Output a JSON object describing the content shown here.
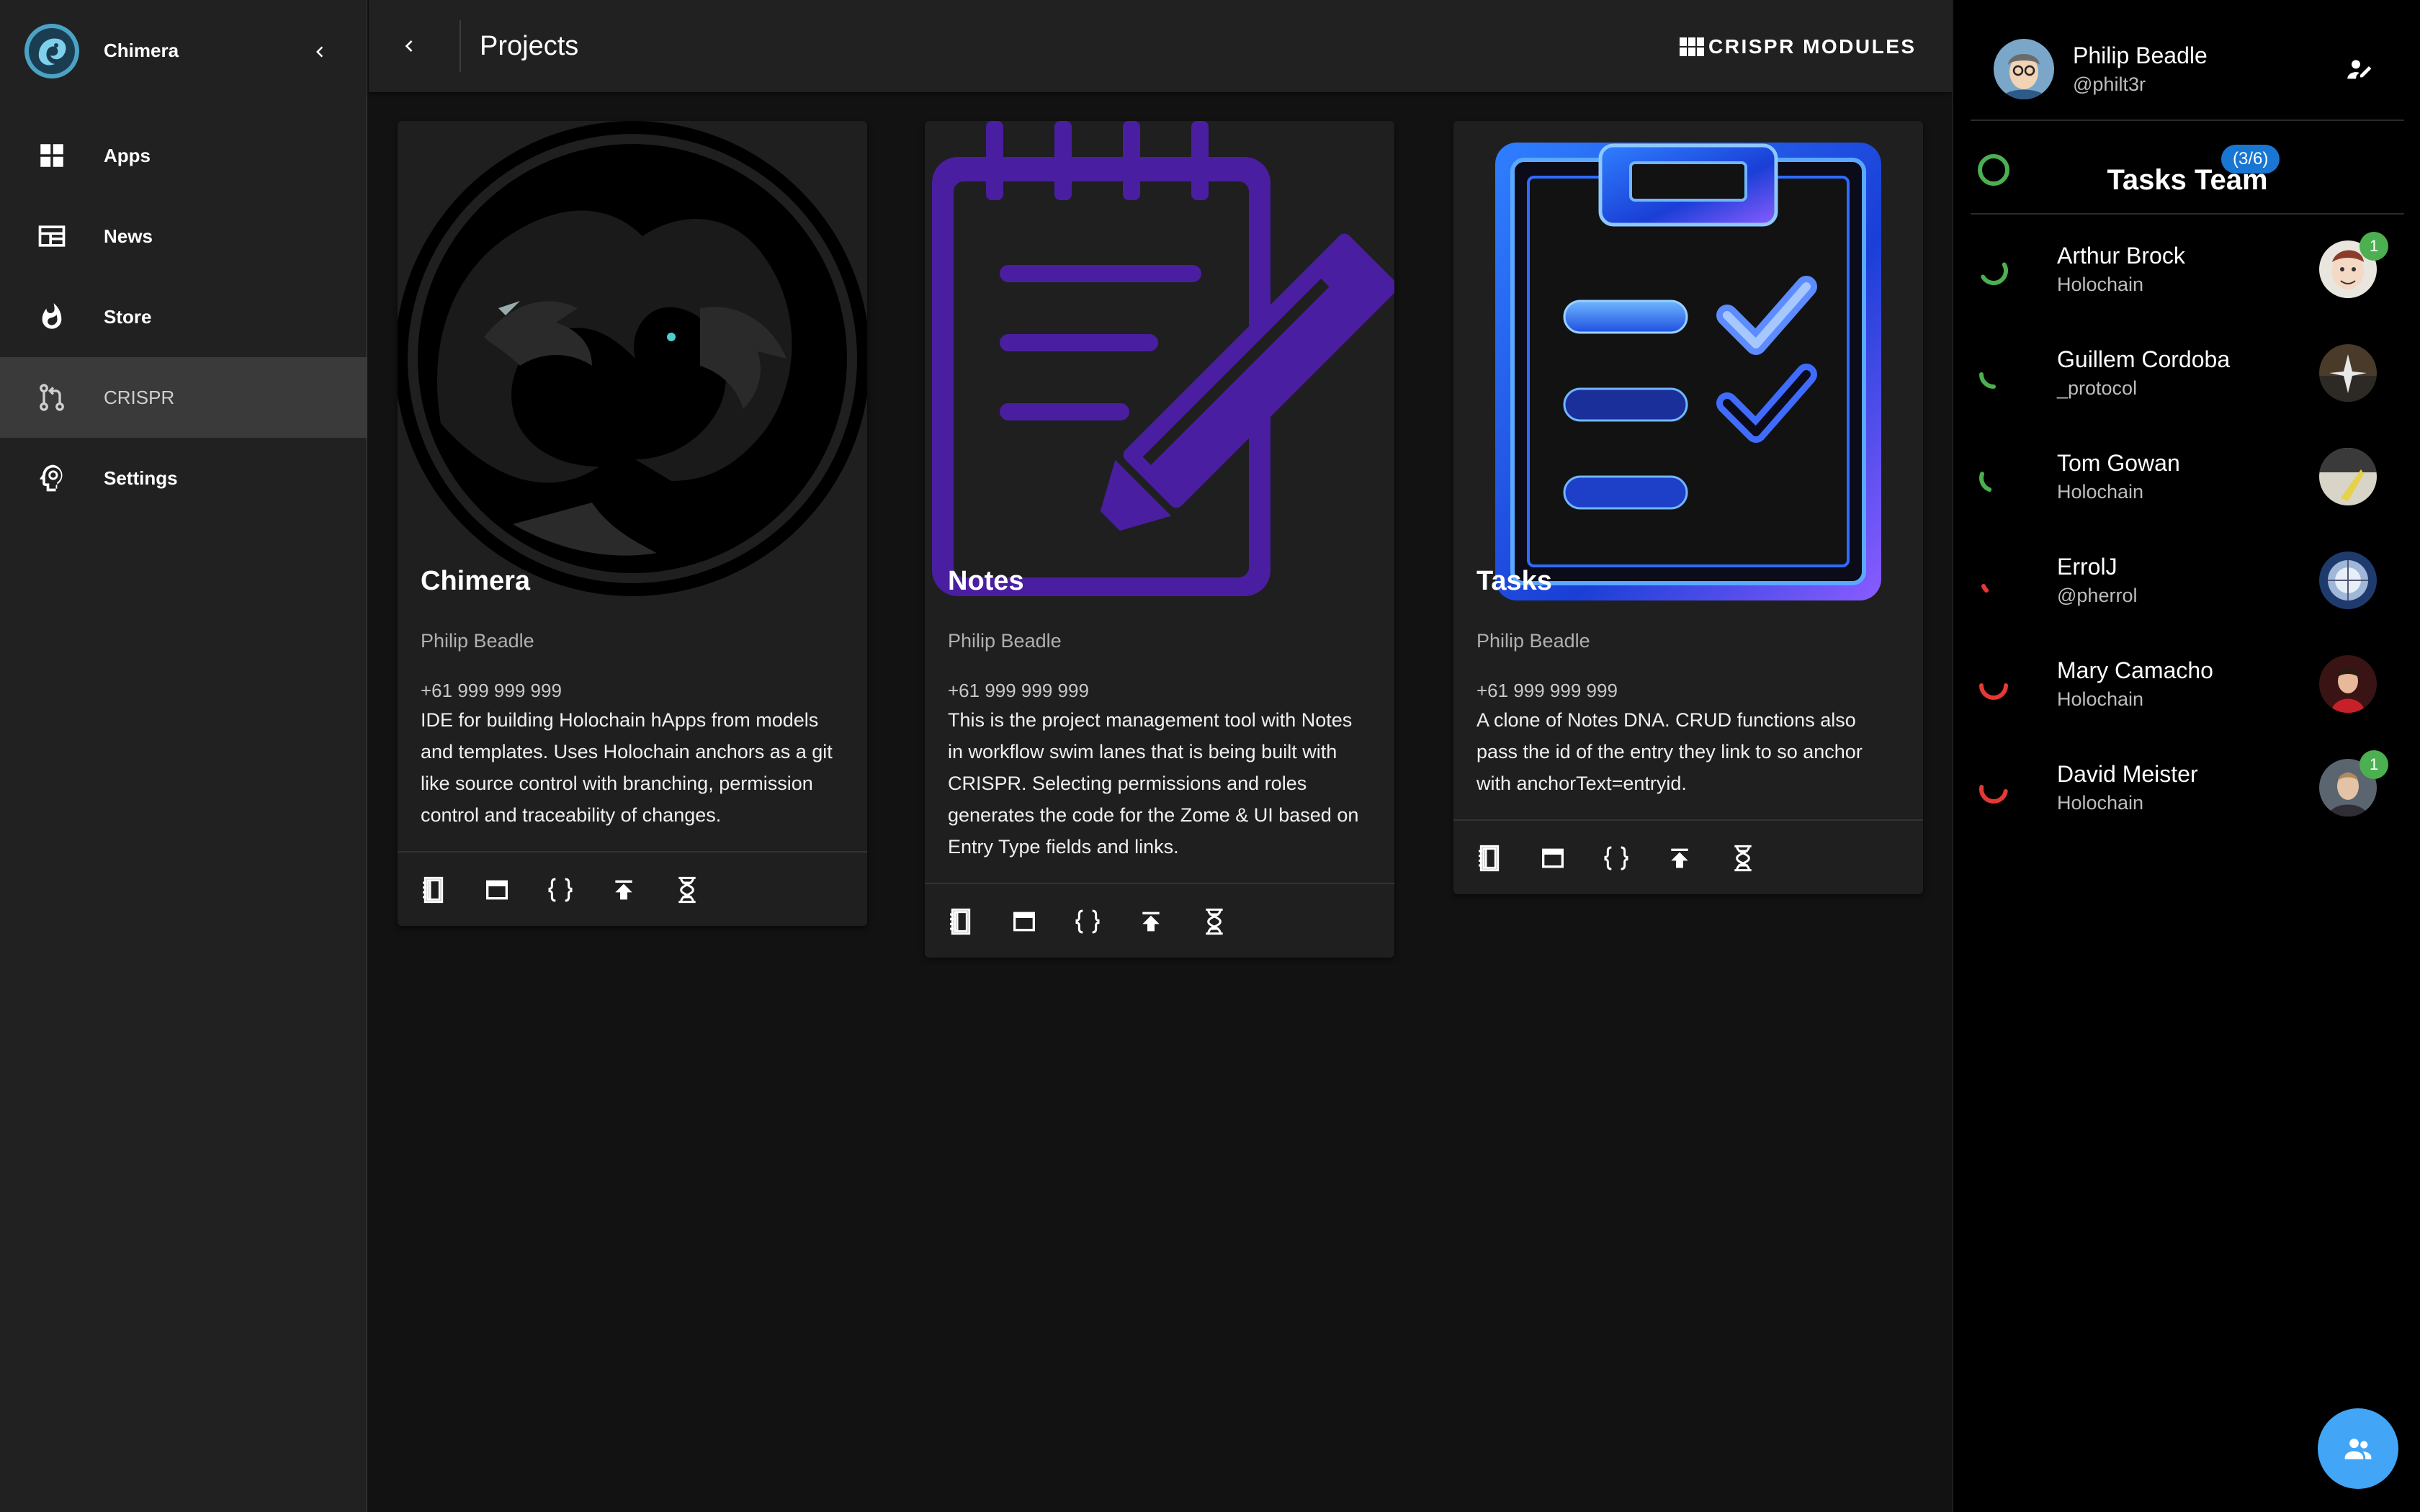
{
  "brand": {
    "name": "Chimera"
  },
  "nav": [
    {
      "label": "Apps",
      "icon": "apps-grid-icon",
      "active": false
    },
    {
      "label": "News",
      "icon": "news-icon",
      "active": false
    },
    {
      "label": "Store",
      "icon": "fire-icon",
      "active": false
    },
    {
      "label": "CRISPR",
      "icon": "source-branch-icon",
      "active": true
    },
    {
      "label": "Settings",
      "icon": "head-gear-icon",
      "active": false
    }
  ],
  "topbar": {
    "title": "Projects",
    "modules_label": "CRISPR MODULES"
  },
  "cards": [
    {
      "title": "Chimera",
      "author": "Philip Beadle",
      "phone": "+61 999 999 999",
      "description": "IDE for building Holochain hApps from models and templates. Uses Holochain anchors as a git like source control with branching, permission control and traceability of changes."
    },
    {
      "title": "Notes",
      "author": "Philip Beadle",
      "phone": "+61 999 999 999",
      "description": "This is the project management tool with Notes in workflow swim lanes that is being built with CRISPR. Selecting permissions and roles generates the code for the Zome & UI based on Entry Type fields and links."
    },
    {
      "title": "Tasks",
      "author": "Philip Beadle",
      "phone": "+61 999 999 999",
      "description": "A clone of Notes DNA. CRUD functions also pass the id of the entry they link to so anchor with anchorText=entryid."
    }
  ],
  "card_actions": [
    "notebook-icon",
    "window-icon",
    "code-braces-icon",
    "publish-icon",
    "dna-icon"
  ],
  "profile": {
    "name": "Philip Beadle",
    "handle": "@philt3r"
  },
  "team": {
    "name": "Tasks Team",
    "badge": "(3/6)"
  },
  "members": [
    {
      "name": "Arthur Brock",
      "sub": "Holochain",
      "status": "online",
      "count": "1"
    },
    {
      "name": "Guillem Cordoba",
      "sub": "_protocol",
      "status": "online",
      "count": ""
    },
    {
      "name": "Tom Gowan",
      "sub": "Holochain",
      "status": "online",
      "count": ""
    },
    {
      "name": "ErrolJ",
      "sub": "@pherrol",
      "status": "offline",
      "count": ""
    },
    {
      "name": "Mary Camacho",
      "sub": "Holochain",
      "status": "offline",
      "count": ""
    },
    {
      "name": "David Meister",
      "sub": "Holochain",
      "status": "offline",
      "count": "1"
    }
  ],
  "colors": {
    "online": "#4caf50",
    "offline": "#e53935",
    "accent": "#42a5f5",
    "badge": "#1976d2"
  }
}
